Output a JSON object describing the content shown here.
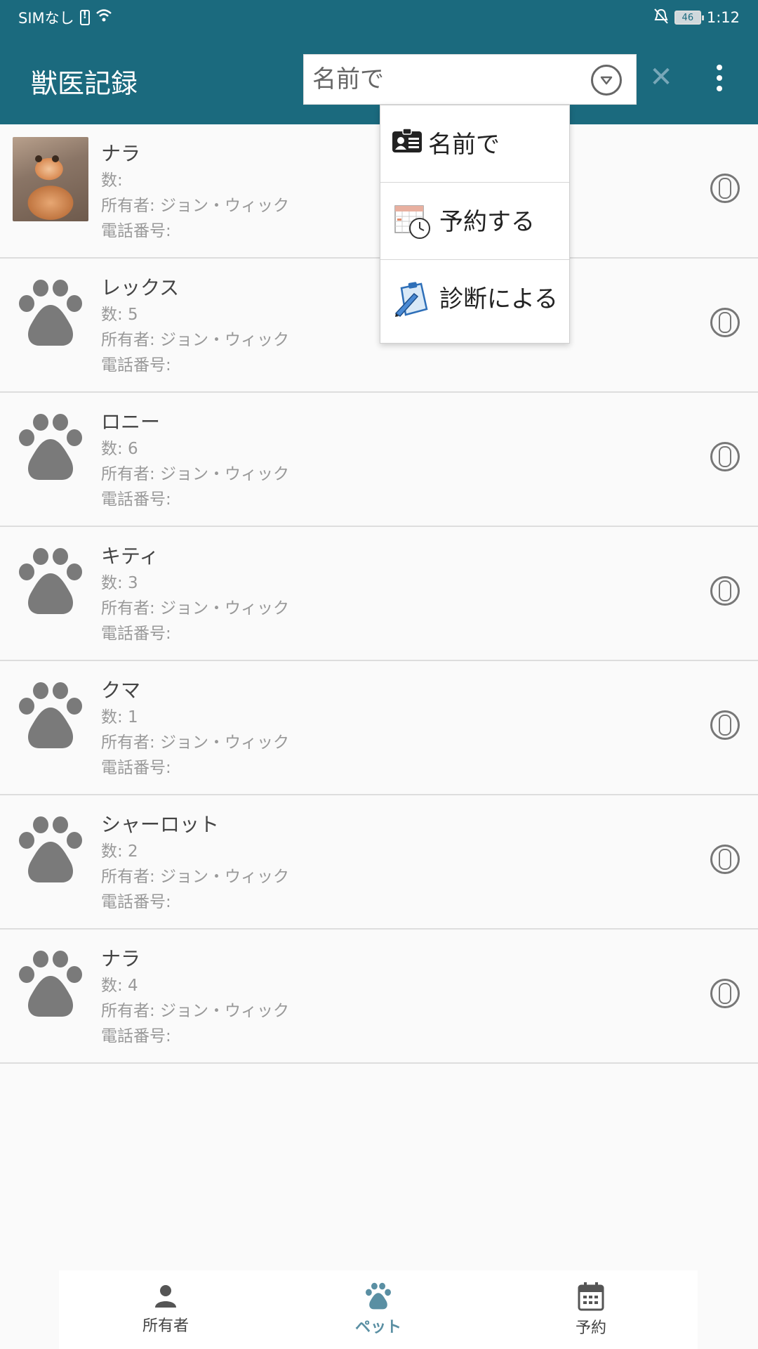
{
  "status_bar": {
    "carrier": "SIMなし",
    "battery": "46",
    "time": "1:12"
  },
  "app_bar": {
    "title": "獣医記録",
    "search_placeholder": "名前で"
  },
  "dropdown": {
    "items": [
      {
        "label": "名前で",
        "icon": "id-card-icon"
      },
      {
        "label": "予約する",
        "icon": "calendar-clock-icon"
      },
      {
        "label": "診断による",
        "icon": "clipboard-pen-icon"
      }
    ]
  },
  "pets": [
    {
      "name": "ナラ",
      "count": "数:",
      "owner": "所有者: ジョン・ウィック",
      "phone": "電話番号:",
      "avatar": "cat-photo"
    },
    {
      "name": "レックス",
      "count": "数: 5",
      "owner": "所有者: ジョン・ウィック",
      "phone": "電話番号:",
      "avatar": "paw-icon"
    },
    {
      "name": "ロニー",
      "count": "数: 6",
      "owner": "所有者: ジョン・ウィック",
      "phone": "電話番号:",
      "avatar": "paw-icon"
    },
    {
      "name": "キティ",
      "count": "数: 3",
      "owner": "所有者: ジョン・ウィック",
      "phone": "電話番号:",
      "avatar": "paw-icon"
    },
    {
      "name": "クマ",
      "count": "数: 1",
      "owner": "所有者: ジョン・ウィック",
      "phone": "電話番号:",
      "avatar": "paw-icon"
    },
    {
      "name": "シャーロット",
      "count": "数: 2",
      "owner": "所有者: ジョン・ウィック",
      "phone": "電話番号:",
      "avatar": "paw-icon"
    },
    {
      "name": "ナラ",
      "count": "数: 4",
      "owner": "所有者: ジョン・ウィック",
      "phone": "電話番号:",
      "avatar": "paw-icon"
    }
  ],
  "bottom_nav": {
    "items": [
      {
        "label": "所有者",
        "icon": "person-icon",
        "active": false
      },
      {
        "label": "ペット",
        "icon": "paw-icon",
        "active": true
      },
      {
        "label": "予約",
        "icon": "calendar-icon",
        "active": false
      }
    ]
  },
  "colors": {
    "primary": "#1b6a7e",
    "accent": "#5a8fa3",
    "paw": "#7a7a7a"
  }
}
